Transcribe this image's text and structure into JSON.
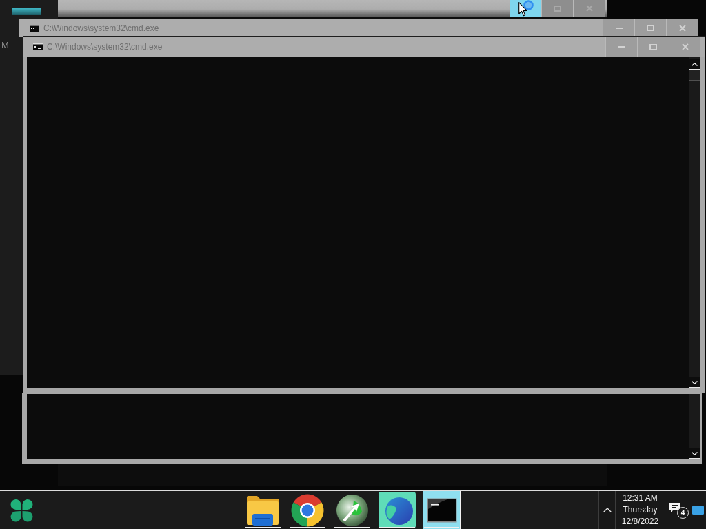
{
  "desktop": {
    "icon_labels": [
      "M"
    ]
  },
  "background_window": {
    "title_buttons": [
      {
        "kind": "minimize",
        "highlighted": true
      },
      {
        "kind": "maximize",
        "highlighted": false
      },
      {
        "kind": "close",
        "highlighted": false
      }
    ]
  },
  "windows": [
    {
      "title": "C:\\Windows\\system32\\cmd.exe",
      "title_buttons": [
        {
          "kind": "minimize"
        },
        {
          "kind": "maximize"
        },
        {
          "kind": "close"
        }
      ]
    },
    {
      "title": "C:\\Windows\\system32\\cmd.exe",
      "title_buttons": [
        {
          "kind": "minimize"
        },
        {
          "kind": "maximize"
        },
        {
          "kind": "close"
        }
      ]
    }
  ],
  "taskbar": {
    "apps": [
      {
        "kind": "folder",
        "running": true,
        "selected": false
      },
      {
        "kind": "browser",
        "running": true,
        "selected": false
      },
      {
        "kind": "sphere",
        "running": true,
        "selected": false
      },
      {
        "kind": "tile",
        "running": true,
        "selected": false
      },
      {
        "kind": "console",
        "running": true,
        "selected": true
      }
    ],
    "clock": {
      "time": "12:31 AM",
      "day": "Thursday",
      "date": "12/8/2022"
    },
    "notifications": {
      "count": "4"
    }
  }
}
